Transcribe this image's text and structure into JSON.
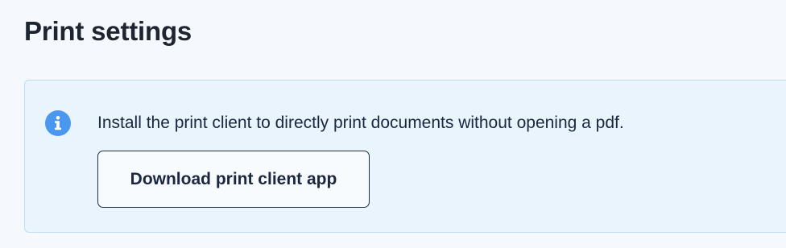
{
  "page": {
    "title": "Print settings"
  },
  "info_box": {
    "icon": "info-icon",
    "message": "Install the print client to directly print documents without opening a pdf.",
    "button_label": "Download print client app"
  },
  "colors": {
    "background": "#f5f9fe",
    "info_box_background": "#e9f4fd",
    "info_box_border": "#bcdcf2",
    "info_icon": "#4a97f0",
    "text": "#1b2640",
    "button_border": "#1f2d4d"
  }
}
